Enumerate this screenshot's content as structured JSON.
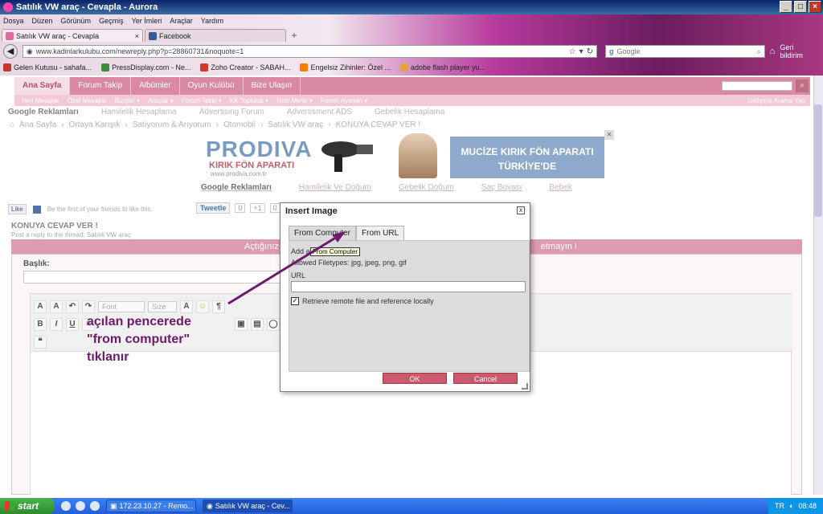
{
  "window": {
    "title": "Satılık VW araç - Cevapla - Aurora"
  },
  "menu": [
    "Dosya",
    "Düzen",
    "Görünüm",
    "Geçmiş",
    "Yer İmleri",
    "Araçlar",
    "Yardım"
  ],
  "tabs": [
    {
      "label": "Satılık VW araç - Cevapla",
      "icon": "pink-favicon"
    },
    {
      "label": "Facebook",
      "icon": "facebook-icon"
    }
  ],
  "nav": {
    "url": "www.kadinlarkulubu.com/newreply.php?p=28860731&noquote=1",
    "search_placeholder": "Google",
    "user_label": "Geri bildirim"
  },
  "bookmarks": [
    {
      "label": "Gelen Kutusu - sahafa...",
      "icon": "gmail-icon",
      "color": "#c0392b"
    },
    {
      "label": "PressDisplay.com - Ne...",
      "icon": "pressdisplay-icon",
      "color": "#3a8d3a"
    },
    {
      "label": "Zoho Creator - SABAH...",
      "icon": "zoho-icon",
      "color": "#d03a2a"
    },
    {
      "label": "Engelsiz Zihinler: Özel ...",
      "icon": "blogger-icon",
      "color": "#f57d00"
    },
    {
      "label": "adobe flash player yu...",
      "icon": "dh-icon",
      "color": "#e6a23c"
    }
  ],
  "site": {
    "nav": [
      "Ana Sayfa",
      "Forum Takip",
      "Albümler",
      "Oyun Kulübü",
      "Bize Ulaşın"
    ],
    "subnav": [
      "Yeni Mesajlar",
      "Özel Mesajlar",
      "Burçlar ▾",
      "Araçlar ▾",
      "Forum Takip ▾",
      "KK Topluluk ▾",
      "Hızlı Menü ▾",
      "Forum Ayarları ▾"
    ],
    "advanced_search": "Gelişmiş Arama Yap",
    "ad_links": [
      "Google Reklamları",
      "Hamilelik Hesaplama",
      "Advertising Forum",
      "Advertisment ADS",
      "Gebelik Hesaplama"
    ],
    "breadcrumb": [
      "Ana Sayfa",
      "Ortaya Karışık",
      "Satıyorum & Arıyorum",
      "Otomobil",
      "Satılık VW araç",
      "KONUYA CEVAP VER !"
    ]
  },
  "banner": {
    "logo": "PRODIVA",
    "sub": "KIRIK FÖN APARATI",
    "url": "www.prodiva.com.tr",
    "box_line1": "MUCİZE KIRIK FÖN APARATI",
    "box_line2": "TÜRKİYE'DE",
    "links": [
      "Google Reklamları",
      "Hamilelik Ve Doğum",
      "Gebelik Doğum",
      "Saç Boyası",
      "Bebek"
    ]
  },
  "social": {
    "like": "Like",
    "fb_text": "Be the first of your friends to like this.",
    "tweet": "Tweetle",
    "tweet_count": "0",
    "plus": "+1",
    "plus_count": "0"
  },
  "form": {
    "title": "KONUYA CEVAP VER !",
    "subtitle": "Post a reply to the thread: Satılık VW araç",
    "header_left": "Açtığınız",
    "header_right": "etmayın !",
    "baslik_label": "Başlık:",
    "font_label": "Font",
    "size_label": "Size"
  },
  "dialog": {
    "title": "Insert Image",
    "tab_computer": "From Computer",
    "tab_url": "From URL",
    "add_label": "Add an",
    "tooltip": "From Computer",
    "allowed": "Allowed Filetypes: jpg, jpeg, png, gif",
    "url_label": "URL",
    "checkbox_label": "Retrieve remote file and reference locally",
    "checkbox_checked": true,
    "ok": "OK",
    "cancel": "Cancel"
  },
  "annotation": {
    "line1": "açılan pencerede",
    "line2": "\"from computer\"",
    "line3": "tıklanır",
    "color": "#6c1a6c"
  },
  "taskbar": {
    "start": "start",
    "items": [
      {
        "label": "172.23.10.27 - Remo..."
      },
      {
        "label": "Satılık VW araç - Cev..."
      }
    ],
    "lang": "TR",
    "time": "08:48"
  }
}
